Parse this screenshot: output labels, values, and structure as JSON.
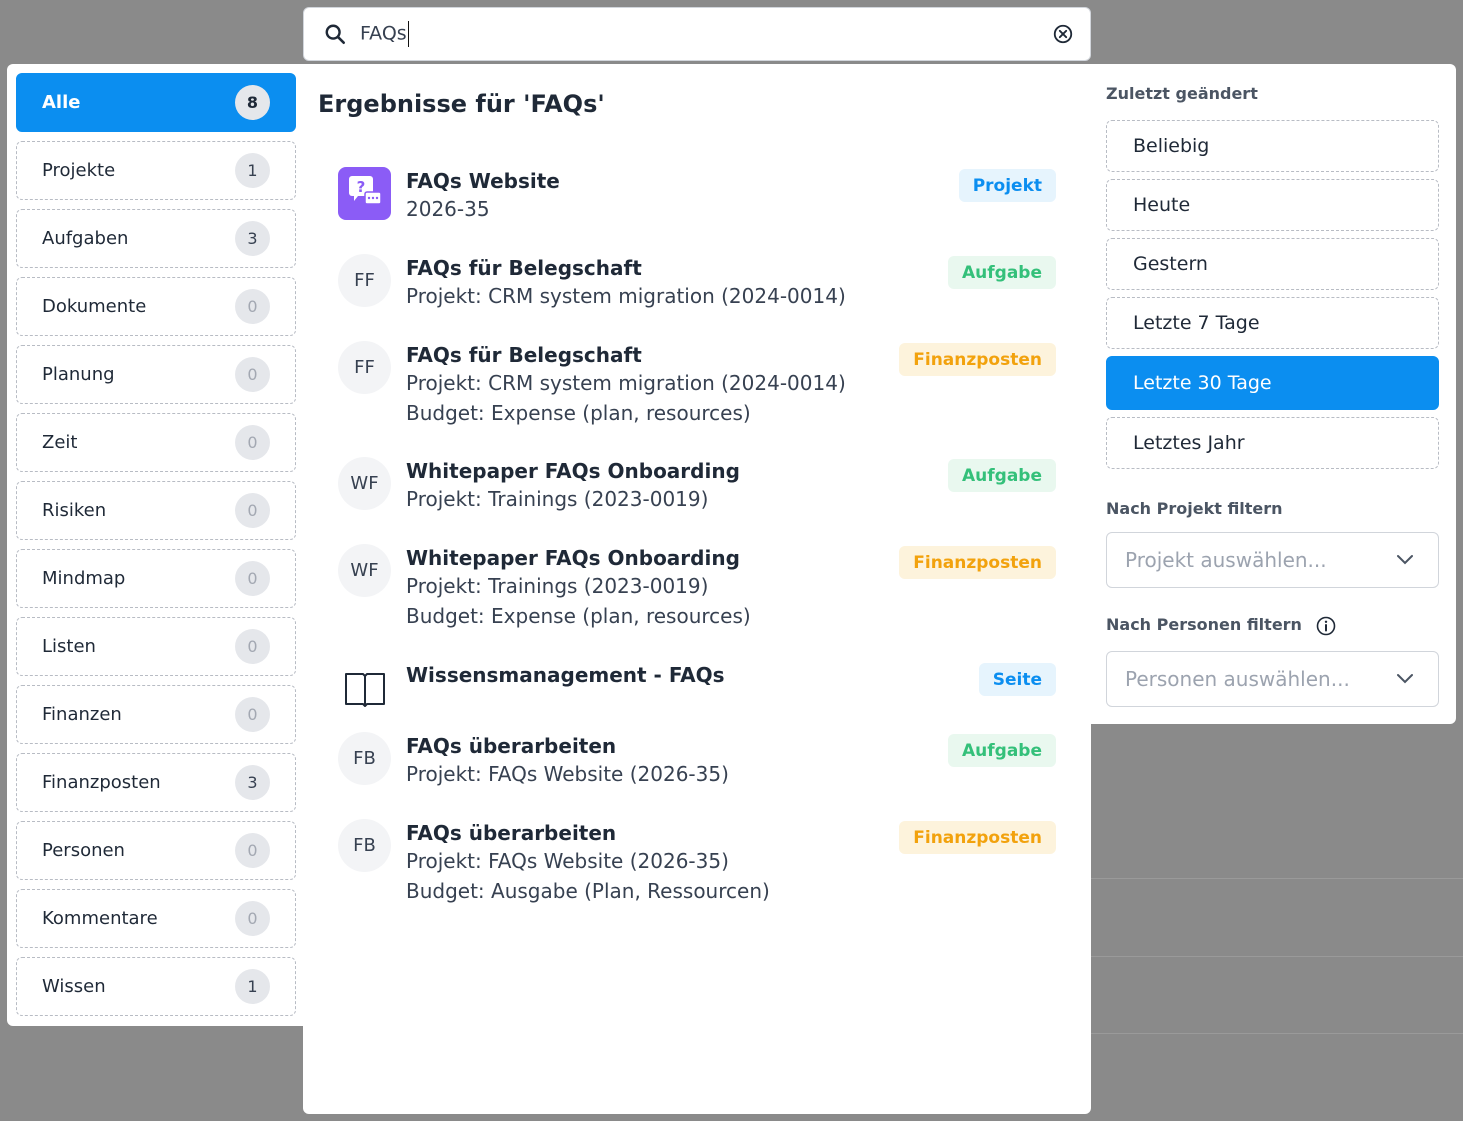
{
  "search": {
    "query": "FAQs"
  },
  "categories": [
    {
      "label": "Alle",
      "count": "8",
      "active": true
    },
    {
      "label": "Projekte",
      "count": "1"
    },
    {
      "label": "Aufgaben",
      "count": "3"
    },
    {
      "label": "Dokumente",
      "count": "0"
    },
    {
      "label": "Planung",
      "count": "0"
    },
    {
      "label": "Zeit",
      "count": "0"
    },
    {
      "label": "Risiken",
      "count": "0"
    },
    {
      "label": "Mindmap",
      "count": "0"
    },
    {
      "label": "Listen",
      "count": "0"
    },
    {
      "label": "Finanzen",
      "count": "0"
    },
    {
      "label": "Finanzposten",
      "count": "3"
    },
    {
      "label": "Personen",
      "count": "0"
    },
    {
      "label": "Kommentare",
      "count": "0"
    },
    {
      "label": "Wissen",
      "count": "1"
    }
  ],
  "results": {
    "heading": "Ergebnisse für 'FAQs'",
    "items": [
      {
        "title": "FAQs Website",
        "lines": [
          "2026-35"
        ],
        "badge": "Projekt",
        "initials": ""
      },
      {
        "title": "FAQs für Belegschaft",
        "lines": [
          "Projekt: CRM system migration (2024-0014)"
        ],
        "badge": "Aufgabe",
        "initials": "FF"
      },
      {
        "title": "FAQs für Belegschaft",
        "lines": [
          "Projekt: CRM system migration (2024-0014)",
          "Budget: Expense (plan, resources)"
        ],
        "badge": "Finanzposten",
        "initials": "FF"
      },
      {
        "title": "Whitepaper FAQs Onboarding",
        "lines": [
          "Projekt: Trainings (2023-0019)"
        ],
        "badge": "Aufgabe",
        "initials": "WF"
      },
      {
        "title": "Whitepaper FAQs Onboarding",
        "lines": [
          "Projekt: Trainings (2023-0019)",
          "Budget: Expense (plan, resources)"
        ],
        "badge": "Finanzposten",
        "initials": "WF"
      },
      {
        "title": "Wissensmanagement - FAQs",
        "lines": [],
        "badge": "Seite",
        "initials": ""
      },
      {
        "title": "FAQs überarbeiten",
        "lines": [
          "Projekt: FAQs Website (2026-35)"
        ],
        "badge": "Aufgabe",
        "initials": "FB"
      },
      {
        "title": "FAQs überarbeiten",
        "lines": [
          "Projekt: FAQs Website (2026-35)",
          "Budget: Ausgabe (Plan, Ressourcen)"
        ],
        "badge": "Finanzposten",
        "initials": "FB"
      }
    ]
  },
  "filters": {
    "modified_label": "Zuletzt geändert",
    "date_options": [
      {
        "label": "Beliebig"
      },
      {
        "label": "Heute"
      },
      {
        "label": "Gestern"
      },
      {
        "label": "Letzte 7 Tage"
      },
      {
        "label": "Letzte 30 Tage",
        "active": true
      },
      {
        "label": "Letztes Jahr"
      }
    ],
    "project_label": "Nach Projekt filtern",
    "project_placeholder": "Projekt auswählen...",
    "people_label": "Nach Personen filtern",
    "people_placeholder": "Personen auswählen..."
  },
  "colors": {
    "accent": "#0b8ef0",
    "aufgabe": "#34c07a",
    "finanz": "#f2a20d",
    "project_icon": "#8b5cf6"
  },
  "icons": {
    "search": "search-icon",
    "clear": "clear-circle-icon",
    "chevron": "chevron-down-icon",
    "info": "info-icon",
    "book": "book-icon",
    "faq": "faq-chat-icon"
  }
}
